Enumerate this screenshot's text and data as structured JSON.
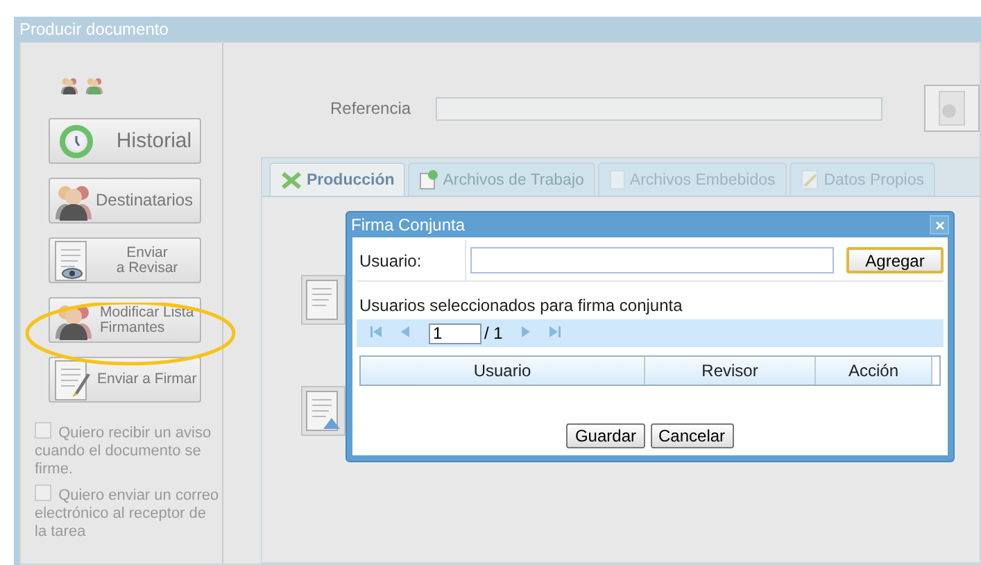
{
  "window": {
    "title": "Producir documento"
  },
  "sidebar": {
    "buttons": [
      {
        "kind": "history",
        "label": "Historial"
      },
      {
        "kind": "recipients",
        "label": "Destinatarios"
      },
      {
        "kind": "review",
        "label": "Enviar\na Revisar"
      },
      {
        "kind": "signers",
        "label": "Modificar Lista\nFirmantes"
      },
      {
        "kind": "sign",
        "label": "Enviar a Firmar"
      }
    ],
    "checkboxes": [
      {
        "label": "Quiero recibir un aviso cuando el documento se firme.",
        "checked": false
      },
      {
        "label": "Quiero enviar un correo electrónico al receptor de la tarea",
        "checked": false
      }
    ]
  },
  "reference": {
    "label": "Referencia"
  },
  "tabs": [
    {
      "label": "Producción",
      "selected": true,
      "disabled": false
    },
    {
      "label": "Archivos de Trabajo",
      "selected": false,
      "disabled": false
    },
    {
      "label": "Archivos Embebidos",
      "selected": false,
      "disabled": true
    },
    {
      "label": "Datos Propios",
      "selected": false,
      "disabled": true
    }
  ],
  "dialog": {
    "title": "Firma Conjunta",
    "user_label": "Usuario:",
    "add_button": "Agregar",
    "list_title": "Usuarios seleccionados para firma conjunta",
    "pager": {
      "page": "1",
      "total": "/ 1"
    },
    "columns": [
      "Usuario",
      "Revisor",
      "Acción"
    ],
    "buttons": [
      "Guardar",
      "Cancelar"
    ]
  }
}
